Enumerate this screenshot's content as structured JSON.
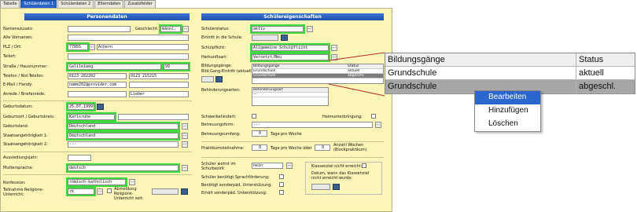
{
  "tabs": [
    "Tabelle",
    "Schülerdaten 1",
    "Schülerdaten 2",
    "Elterndaten",
    "Zusatzfelder"
  ],
  "left": {
    "title": "Personendaten",
    "labels": {
      "namenszusatz": "Namenszusatz:",
      "geschlecht": "Geschlecht:",
      "alle_vornamen": "Alle Vornamen:",
      "plz_ort": "PLZ / Ort:",
      "teilort": "Teilort:",
      "strasse": "Straße / Hausnummer:",
      "telefon": "Telefon / Not-Telefon:",
      "email": "E-Mail / Handy:",
      "anrede": "Anrede / Briefanrede:",
      "geburtsdatum": "Geburtsdatum:",
      "geburtsort": "Geburtsort / Geburtskreis:",
      "geburtsland": "Geburtsland:",
      "staat1": "Staatsangehörigkeit 1:",
      "staat2": "Staatsangehörigkeit 2:",
      "aussiedlungsjahr": "Aussiedlungsjahr:",
      "muttersprache": "Muttersprache:",
      "konfession": "Konfession:",
      "teilnahme": "Teilnahme Religions-Unterricht:",
      "abmeldung": "Abmeldung Religions-Unterricht seit:"
    },
    "values": {
      "geschlecht": "männl.",
      "plz": "77855",
      "ort": "Achern",
      "strasse": "Galileiweg",
      "hausnummer": "99",
      "telefon": "0123 202202",
      "not_telefon": "0123 215215",
      "email": "name202@provider.com",
      "briefanrede": "Lieber",
      "geburtsdatum": "25.07.1999",
      "geburtsort": "Karlsruhe",
      "geburtsland": "Deutschland",
      "staat1": "Deutschland",
      "staat2": "---",
      "muttersprache": "deutsch",
      "konfession": "römisch-katholisch",
      "teilnahme": "rk"
    }
  },
  "right": {
    "title": "Schülereigenschaften",
    "labels": {
      "schuelerstatus": "Schülerstatus:",
      "eintritt": "Eintritt in die Schule:",
      "schulpflicht": "Schulpflicht:",
      "herkunftsart": "Herkunftsart:",
      "bildungsgaenge": "Bildungsgänge:",
      "bild_gang_eintritt": "Bild.Gang-Eintritt (aktuell)",
      "behinderungsarten": "Behinderungsarten:",
      "schwerbehindert": "Schwerbehindert:",
      "heimunterbringung": "Heimunterbringung:",
      "betreuungsform": "Betreuungsform:",
      "betreuungsumfang": "Betreuungsumfang:",
      "tage_pro_woche": "Tage pro Woche",
      "praktikum": "Praktikumsteilnahme:",
      "tage_woche_oder": "Tage pro Woche oder",
      "anzahl_wochen": "Anzahl Wochen (Blockpraktikum)",
      "schueler_wohnt": "Schüler wohnt im Schulbezirk",
      "sprachfoerderung": "Schüler benötigt Sprachförderung:",
      "sonderpaed": "Benötigt sonderpäd. Unterstützung:",
      "erhaelt": "Erhält sonderpäd. Unterstützung:",
      "klassenziel": "Klassenziel nicht erreicht:",
      "datum_klassenziel": "Datum, wann das Klassenziel nicht erreicht wurde:"
    },
    "values": {
      "schuelerstatus": "aktiv",
      "schulpflicht": "Allgemeine Schulpflicht",
      "herkunftsart": "Versetzt/Neu",
      "betreuungsform": "---",
      "betreuungsumfang": "0",
      "praktikum_tage": "0",
      "praktikum_wochen": "0",
      "schueler_wohnt": "nein",
      "behinderungsart_header": "Behinderungsart",
      "behinderungsart_row": "---"
    },
    "mini_grid": {
      "headers": [
        "Bildungsgänge",
        "Status"
      ],
      "rows": [
        [
          "Grundschule",
          "aktuell"
        ],
        [
          "Grundschule",
          "abgeschl."
        ]
      ]
    }
  },
  "zoom_table": {
    "headers": [
      "Bildungsgänge",
      "Status"
    ],
    "rows": [
      [
        "Grundschule",
        "aktuell"
      ],
      [
        "Grundschule",
        "abgeschl."
      ]
    ]
  },
  "context_menu": [
    "Bearbeiten",
    "Hinzufügen",
    "Löschen"
  ],
  "colors": {
    "panel_bg": "#fbf6b8",
    "title_bar": "#2a5fc0",
    "highlight": "#3fd93f",
    "menu_selected": "#2a66cc",
    "callout_line": "#c0292b"
  }
}
